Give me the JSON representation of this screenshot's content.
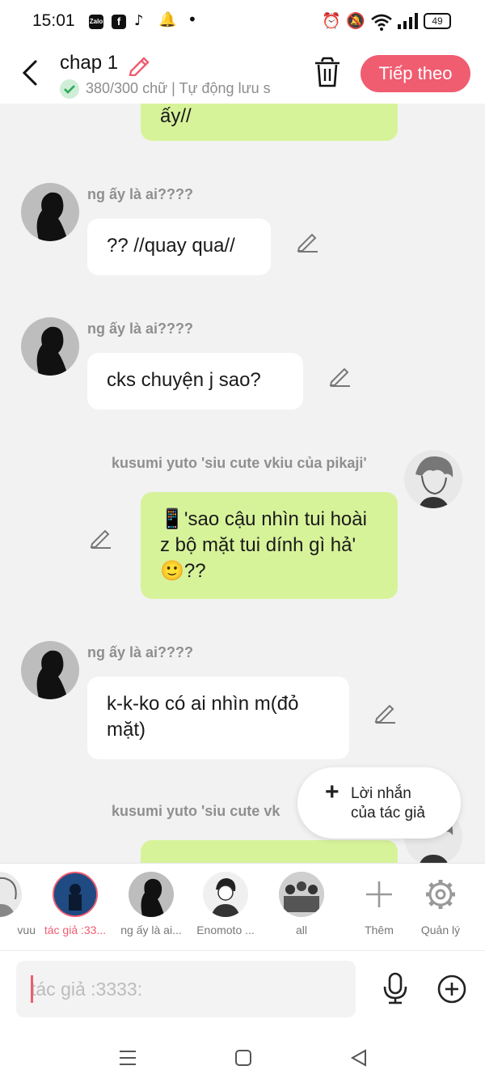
{
  "status_bar": {
    "time": "15:01",
    "app_icons": [
      "Zalo",
      "f",
      "tiktok",
      "bell-alert"
    ],
    "battery": "49"
  },
  "header": {
    "title": "chap 1",
    "word_count": "380/300 chữ | Tự động lưu s",
    "next_button": "Tiếp theo"
  },
  "messages": [
    {
      "side": "right",
      "name": "",
      "text": "ấy//"
    },
    {
      "side": "left",
      "name": "ng ấy là ai????",
      "text": "?? //quay qua//"
    },
    {
      "side": "left",
      "name": "ng ấy là ai????",
      "text": "cks chuyện j sao?"
    },
    {
      "side": "right",
      "name": "kusumi yuto 'siu cute  vkiu của pikaji'",
      "text": "📱'sao cậu nhìn tui hoài z bộ mặt tui dính gì hả' 🙂??"
    },
    {
      "side": "left",
      "name": "ng ấy là ai????",
      "text": "k-k-ko có ai nhìn m(đỏ mặt)"
    },
    {
      "side": "right",
      "name": "kusumi yuto 'siu cute  vk",
      "text": ""
    }
  ],
  "author_note": {
    "line1": "Lời nhắn",
    "line2": "của tác giả"
  },
  "characters": [
    {
      "label": "vuu",
      "selected": false
    },
    {
      "label": "tác giả :33...",
      "selected": true
    },
    {
      "label": "ng ấy là ai...",
      "selected": false
    },
    {
      "label": "Enomoto ...",
      "selected": false
    },
    {
      "label": "all",
      "selected": false
    },
    {
      "label": "Thêm",
      "selected": false
    },
    {
      "label": "Quản lý",
      "selected": false
    }
  ],
  "input": {
    "placeholder": "tác giả :3333:"
  },
  "colors": {
    "accent": "#f05c70",
    "bubble_green": "#d7f39a",
    "bubble_white": "#ffffff"
  }
}
